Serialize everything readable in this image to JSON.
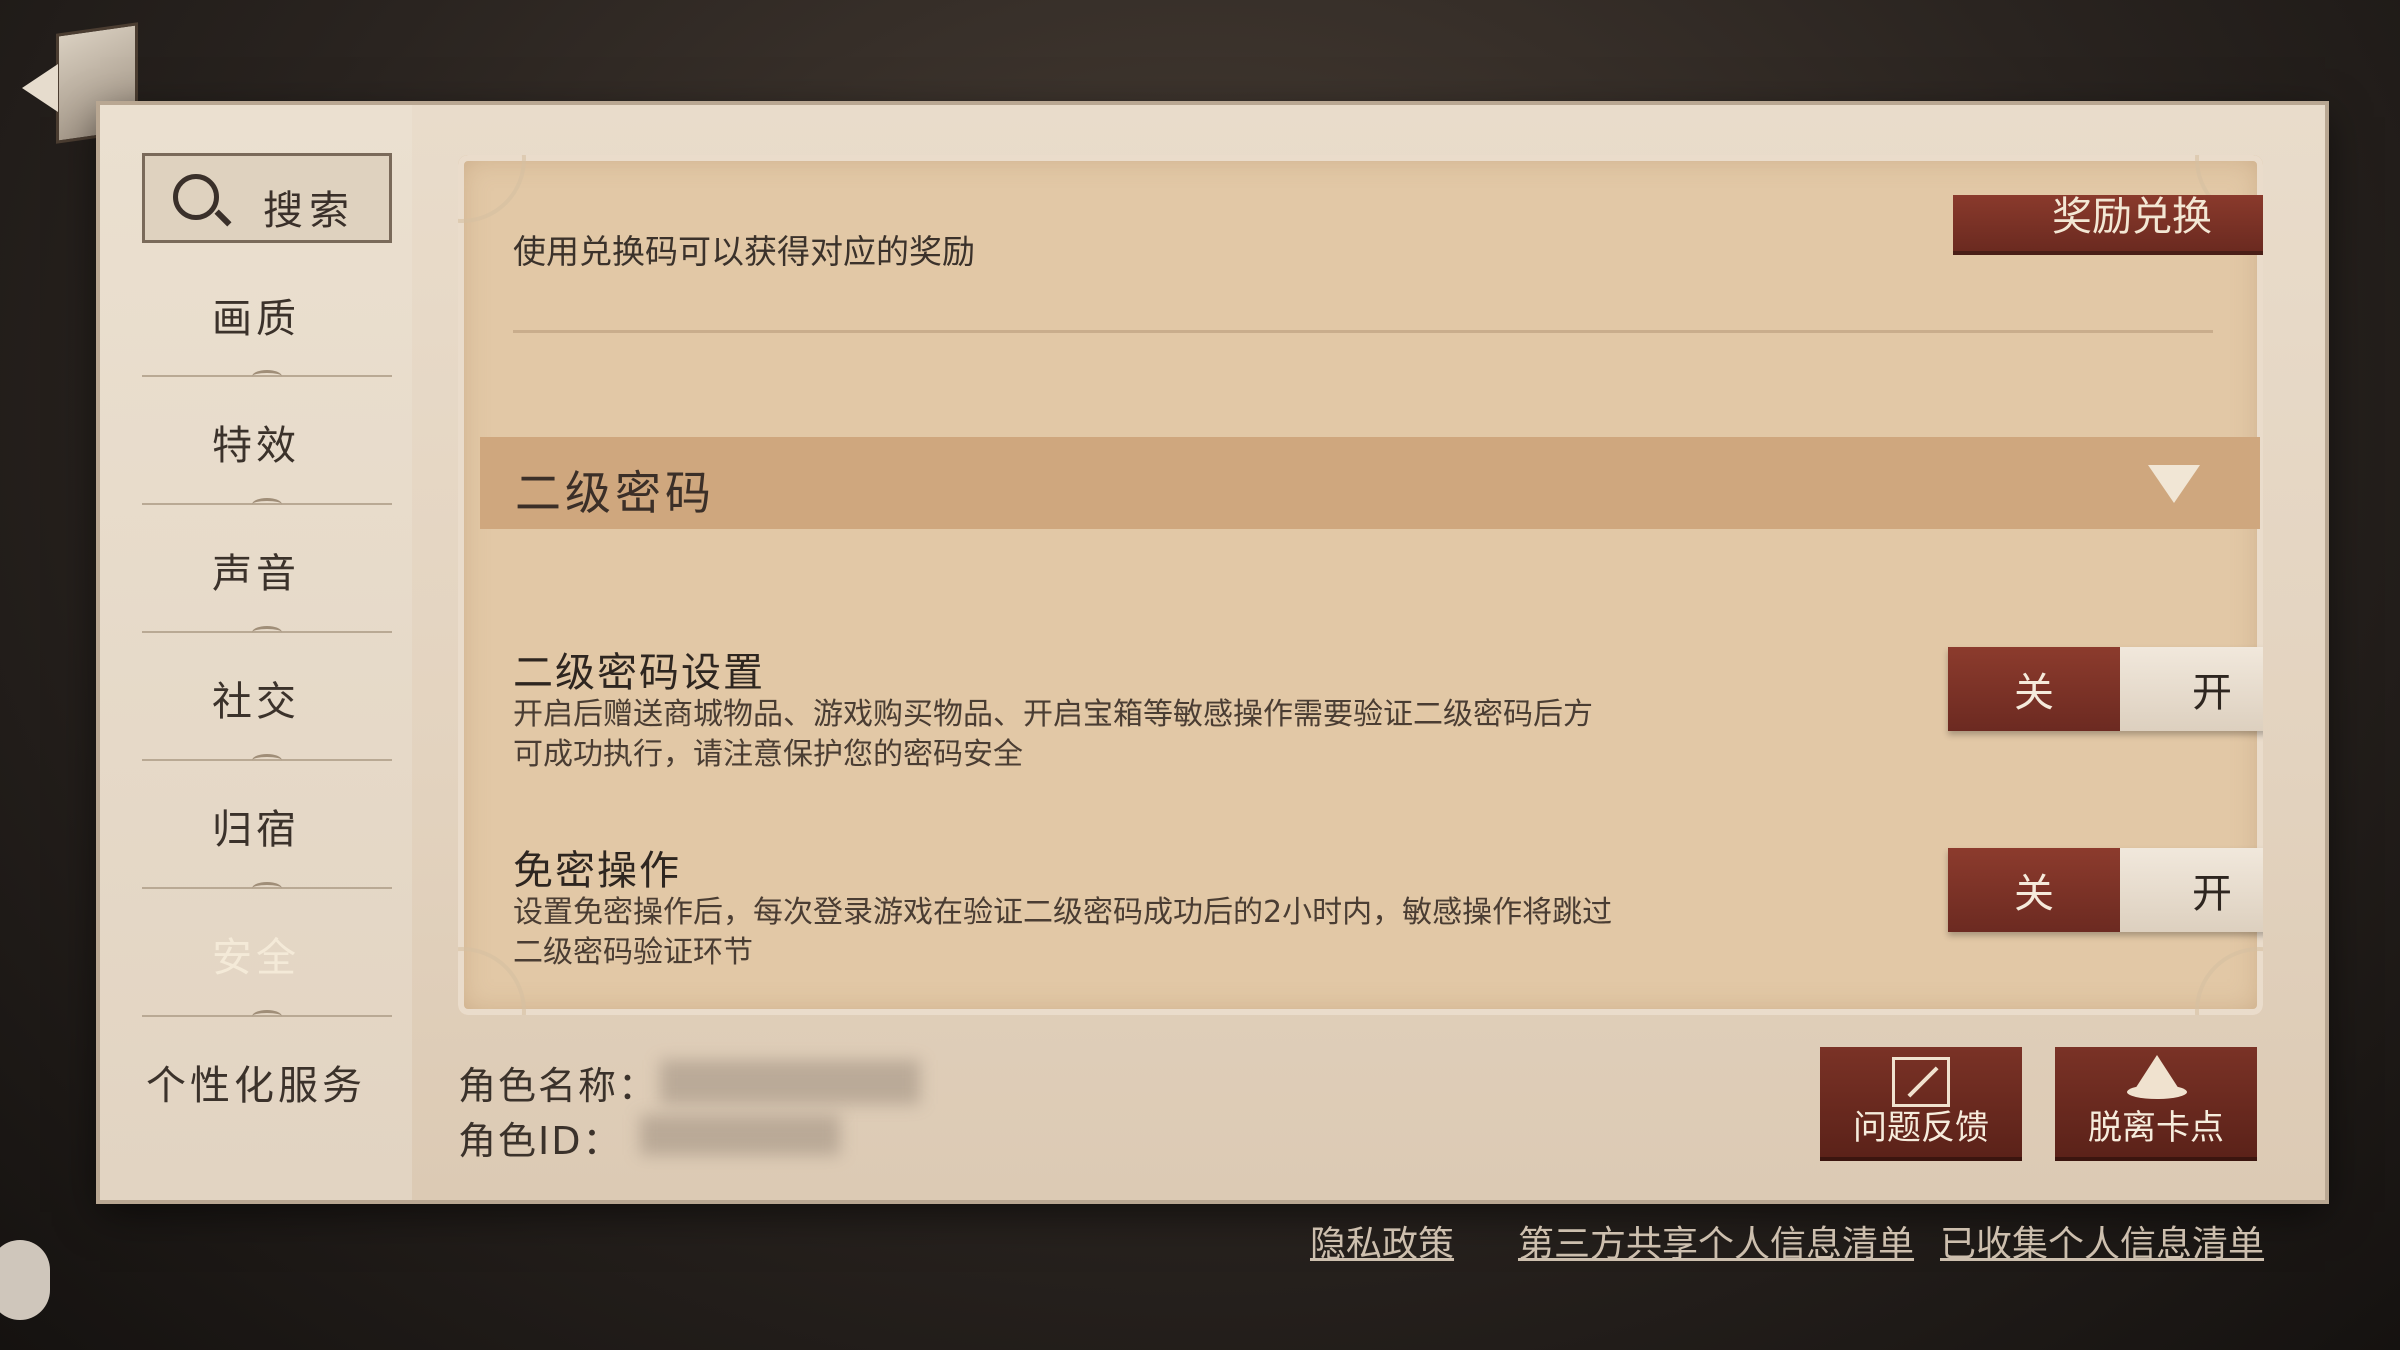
{
  "sidebar": {
    "search_label": "搜索",
    "items": [
      {
        "label": "画质"
      },
      {
        "label": "特效"
      },
      {
        "label": "声音"
      },
      {
        "label": "社交"
      },
      {
        "label": "归宿"
      },
      {
        "label": "安全",
        "active": true
      },
      {
        "label": "个性化服务"
      }
    ]
  },
  "redeem": {
    "description": "使用兑换码可以获得对应的奖励",
    "button_label": "奖励兑换"
  },
  "section": {
    "title": "二级密码"
  },
  "settings": [
    {
      "title": "二级密码设置",
      "description": "开启后赠送商城物品、游戏购买物品、开启宝箱等敏感操作需要验证二级密码后方可成功执行，请注意保护您的密码安全",
      "off_label": "关",
      "on_label": "开",
      "state": "off"
    },
    {
      "title": "免密操作",
      "description": "设置免密操作后，每次登录游戏在验证二级密码成功后的2小时内，敏感操作将跳过二级密码验证环节",
      "off_label": "关",
      "on_label": "开",
      "state": "off"
    }
  ],
  "role": {
    "name_label": "角色名称：",
    "id_label": "角色ID："
  },
  "actions": {
    "feedback_label": "问题反馈",
    "escape_label": "脱离卡点"
  },
  "footer": {
    "privacy_label": "隐私政策",
    "third_party_label": "第三方共享个人信息清单",
    "collected_label": "已收集个人信息清单"
  },
  "colors": {
    "accent": "#7a3226",
    "card": "#e2c8a6",
    "panel": "#e6d8c5"
  }
}
